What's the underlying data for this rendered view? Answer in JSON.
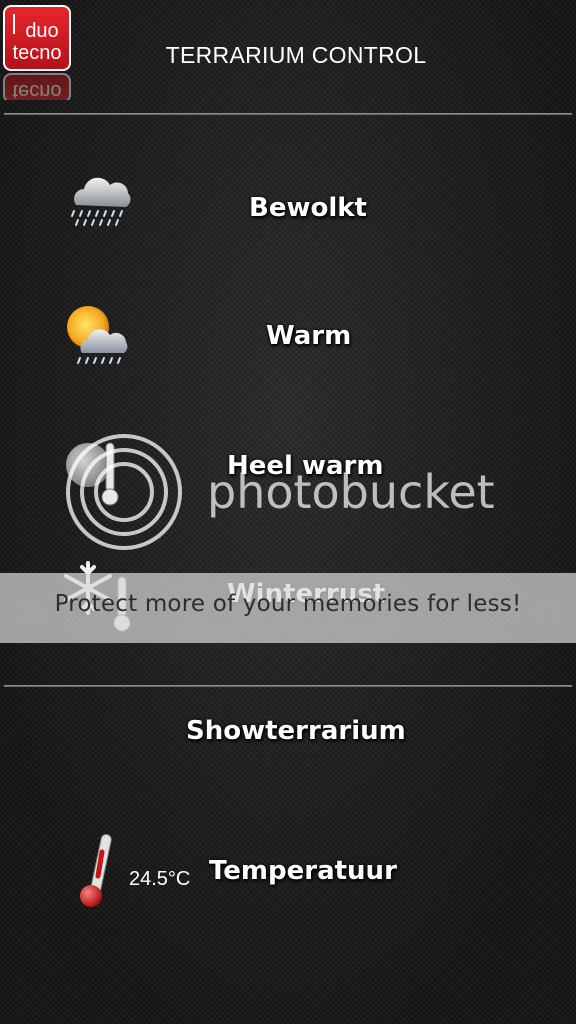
{
  "header": {
    "title": "TERRARIUM CONTROL",
    "logo_text_top": "duo",
    "logo_text_bottom": "tecno",
    "logo_color": "#d0181e"
  },
  "modes": [
    {
      "label": "Bewolkt",
      "icon": "cloud-rain-icon"
    },
    {
      "label": "Warm",
      "icon": "sun-cloud-rain-icon"
    },
    {
      "label": "Heel warm",
      "icon": "thermometer-sun-icon"
    },
    {
      "label": "Winterrust",
      "icon": "snowflake-icon"
    }
  ],
  "show": {
    "label": "Showterrarium"
  },
  "temperature": {
    "label": "Temperatuur",
    "value": "24.5°C",
    "icon": "thermometer-icon"
  },
  "watermark": {
    "brand": "photobucket",
    "tagline": "Protect more of your memories for less!"
  }
}
